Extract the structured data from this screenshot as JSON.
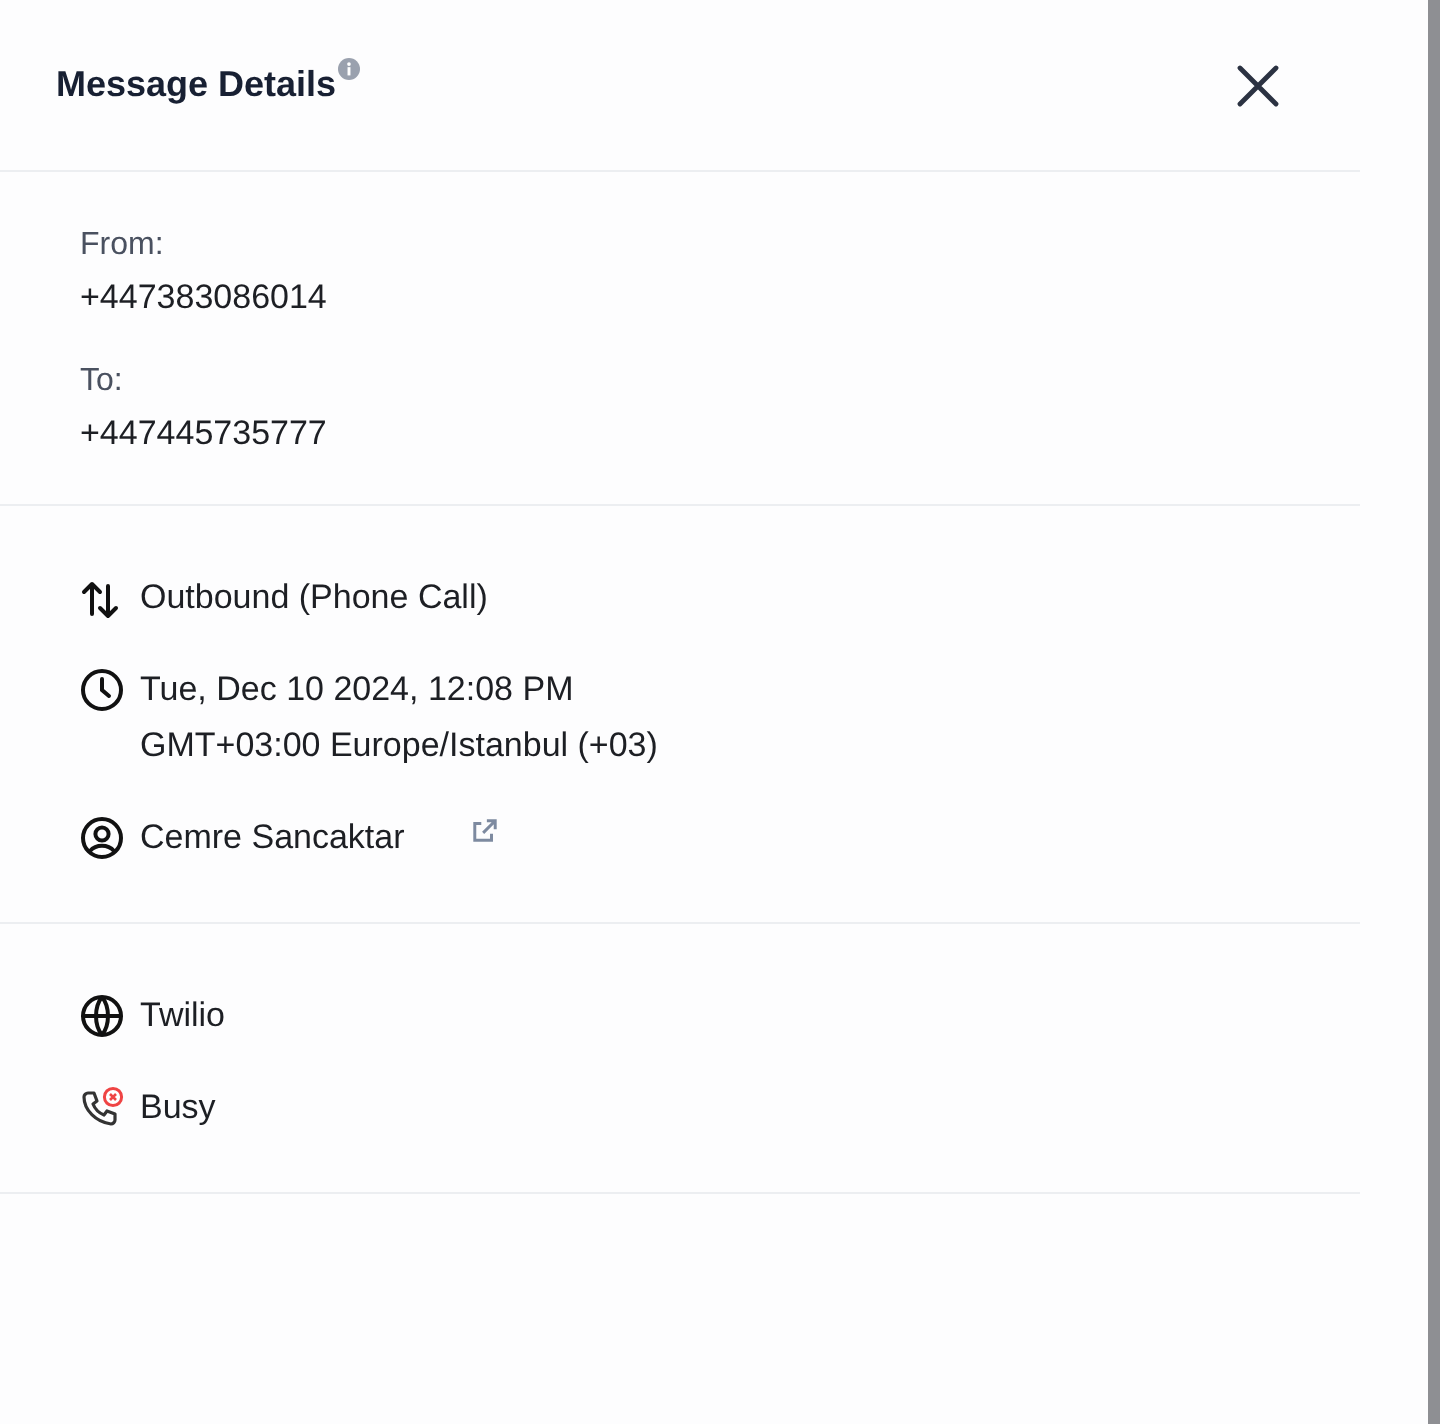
{
  "header": {
    "title": "Message Details"
  },
  "addresses": [
    {
      "label": "From:",
      "value": "+447383086014"
    },
    {
      "label": "To:",
      "value": "+447445735777"
    }
  ],
  "details": [
    {
      "kind": "direction",
      "lines": [
        "Outbound (Phone Call)"
      ]
    },
    {
      "kind": "time",
      "lines": [
        "Tue, Dec 10 2024, 12:08 PM",
        "GMT+03:00 Europe/Istanbul (+03)"
      ]
    },
    {
      "kind": "contact",
      "lines": [
        "Cemre Sancaktar"
      ]
    }
  ],
  "delivery": [
    {
      "kind": "provider",
      "lines": [
        "Twilio"
      ]
    },
    {
      "kind": "status",
      "lines": [
        "Busy"
      ]
    }
  ]
}
